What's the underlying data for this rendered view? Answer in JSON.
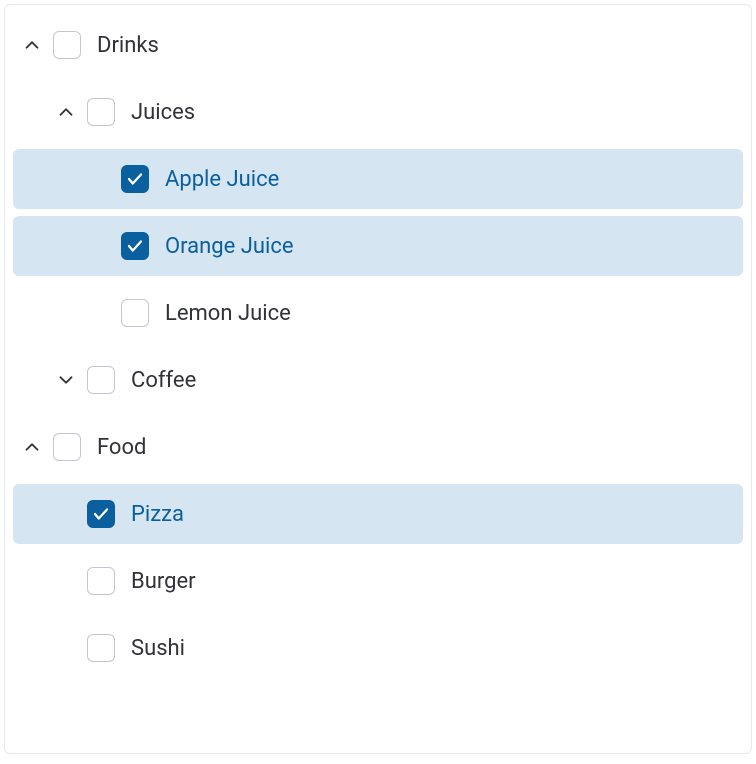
{
  "colors": {
    "accent": "#0a5f9e",
    "selectedBg": "#d6e5f2",
    "text": "#323338",
    "border": "#e6e9ef",
    "checkboxBorder": "#c3c6d4"
  },
  "tree": [
    {
      "id": "drinks",
      "label": "Drinks",
      "level": 0,
      "hasChildren": true,
      "expanded": true,
      "checked": false,
      "selected": false
    },
    {
      "id": "juices",
      "label": "Juices",
      "level": 1,
      "hasChildren": true,
      "expanded": true,
      "checked": false,
      "selected": false
    },
    {
      "id": "apple-juice",
      "label": "Apple Juice",
      "level": 2,
      "hasChildren": false,
      "expanded": false,
      "checked": true,
      "selected": true
    },
    {
      "id": "orange-juice",
      "label": "Orange Juice",
      "level": 2,
      "hasChildren": false,
      "expanded": false,
      "checked": true,
      "selected": true
    },
    {
      "id": "lemon-juice",
      "label": "Lemon Juice",
      "level": 2,
      "hasChildren": false,
      "expanded": false,
      "checked": false,
      "selected": false
    },
    {
      "id": "coffee",
      "label": "Coffee",
      "level": 1,
      "hasChildren": true,
      "expanded": false,
      "checked": false,
      "selected": false
    },
    {
      "id": "food",
      "label": "Food",
      "level": 0,
      "hasChildren": true,
      "expanded": true,
      "checked": false,
      "selected": false
    },
    {
      "id": "pizza",
      "label": "Pizza",
      "level": 1,
      "hasChildren": false,
      "expanded": false,
      "checked": true,
      "selected": true
    },
    {
      "id": "burger",
      "label": "Burger",
      "level": 1,
      "hasChildren": false,
      "expanded": false,
      "checked": false,
      "selected": false
    },
    {
      "id": "sushi",
      "label": "Sushi",
      "level": 1,
      "hasChildren": false,
      "expanded": false,
      "checked": false,
      "selected": false
    }
  ]
}
